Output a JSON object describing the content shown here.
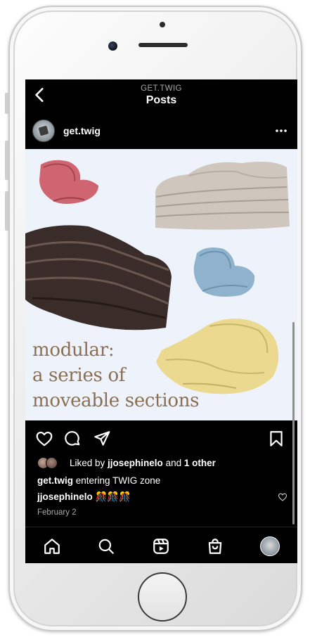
{
  "header": {
    "account_label": "GET.TWIG",
    "title": "Posts"
  },
  "post": {
    "username": "get.twig",
    "image_caption_lines": [
      "modular:",
      "a series of",
      "moveable sections"
    ],
    "likes": {
      "prefix": "Liked by ",
      "first_user": "jjosephinelo",
      "connector": " and ",
      "others": "1 other"
    },
    "caption": {
      "username": "get.twig",
      "text": " entering TWIG zone"
    },
    "comment": {
      "username": "jjosephinelo",
      "text": " 🎊🎊🎊"
    },
    "date": "February 2"
  },
  "icons": {
    "back": "chevron-left-icon",
    "more": "more-horizontal-icon",
    "like": "heart-icon",
    "comment": "comment-icon",
    "share": "send-icon",
    "save": "bookmark-icon",
    "home": "home-icon",
    "search": "search-icon",
    "reels": "reels-icon",
    "shop": "shop-bag-icon",
    "profile": "profile-avatar"
  },
  "colors": {
    "screen_bg": "#000000",
    "image_bg": "#edf2fb",
    "image_text": "#8a6f52",
    "secondary_text": "#a8a8a8"
  }
}
